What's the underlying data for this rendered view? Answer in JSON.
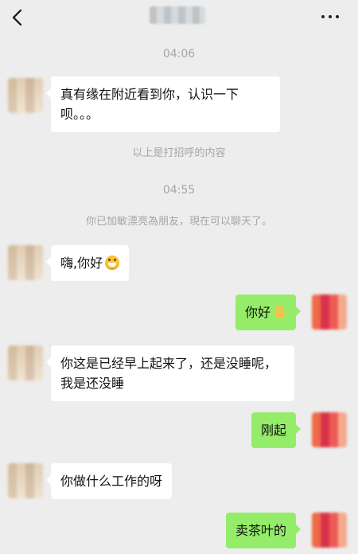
{
  "header": {
    "back_icon": "chevron-left-icon",
    "title_obscured": true,
    "more_icon": "more-dots-icon"
  },
  "timestamps": [
    "04:06",
    "04:55"
  ],
  "system_messages": [
    "以上是打招呼的内容",
    "你已加敏漂亮為朋友，現在可以聊天了。"
  ],
  "messages": [
    {
      "side": "left",
      "text": "真有缘在附近看到你，认识一下呗。。。"
    },
    {
      "side": "left",
      "text": "嗨,你好",
      "emoji": "grinning-face-icon"
    },
    {
      "side": "right",
      "text": "你好",
      "emoji": "waving-hand-icon"
    },
    {
      "side": "left",
      "text": "你这是已经早上起来了，还是没睡呢，我是还没睡"
    },
    {
      "side": "right",
      "text": "刚起"
    },
    {
      "side": "left",
      "text": "你做什么工作的呀"
    },
    {
      "side": "right",
      "text": "卖茶叶的"
    }
  ],
  "colors": {
    "background": "#ededed",
    "bubble_other": "#ffffff",
    "bubble_self": "#95ec69",
    "meta_text": "#a6a6a6"
  }
}
